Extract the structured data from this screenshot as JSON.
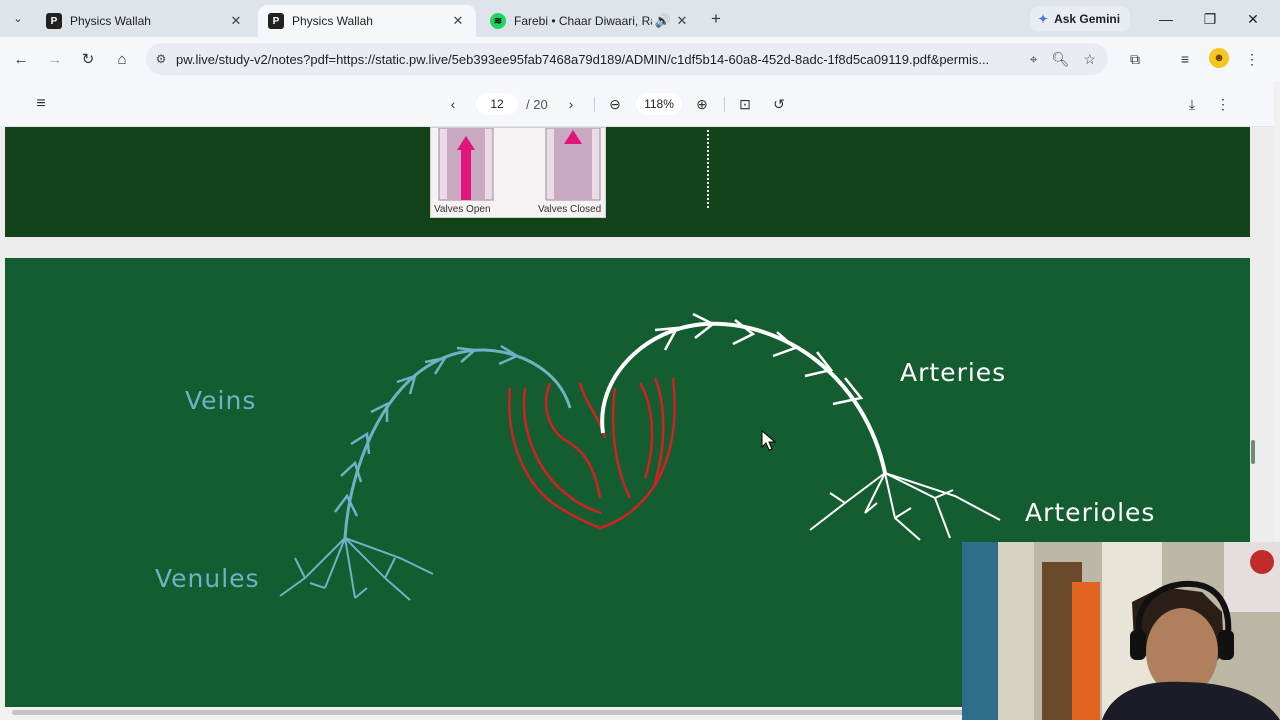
{
  "tabs": [
    {
      "title": "Physics Wallah",
      "active": false
    },
    {
      "title": "Physics Wallah",
      "active": true
    },
    {
      "title": "Farebi • Chaar Diwaari, Raft...",
      "active": false
    }
  ],
  "gemini_label": "Ask Gemini",
  "url": "pw.live/study-v2/notes?pdf=https://static.pw.live/5eb393ee95fab7468a79d189/ADMIN/c1df5b14-60a8-452d-8adc-1f8d5ca09119.pdf&permis...",
  "pdf": {
    "page_current": "12",
    "page_total": "/ 20",
    "zoom": "118%"
  },
  "figure_labels": {
    "valves_open": "Valves Open",
    "valves_closed": "Valves Closed"
  },
  "board": {
    "veins": "Veins",
    "venules": "Venules",
    "arteries": "Arteries",
    "arterioles": "Arterioles"
  },
  "colors": {
    "board_green": "#135d31",
    "veins_blue": "#6fb2c5",
    "heart_red": "#d42020",
    "arteries_white": "#ffffff"
  }
}
